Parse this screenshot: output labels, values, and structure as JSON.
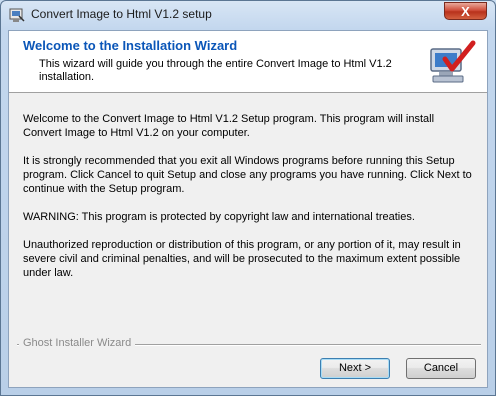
{
  "window": {
    "title": "Convert Image to Html V1.2 setup",
    "close_glyph": "X"
  },
  "header": {
    "title": "Welcome to the Installation Wizard",
    "subtitle": "This wizard will guide you through the entire Convert Image to Html V1.2 installation."
  },
  "body": {
    "paragraphs": [
      "Welcome to the Convert Image to Html V1.2 Setup program. This program will install Convert Image to Html V1.2 on your computer.",
      "It is strongly recommended that you exit all Windows programs before running this Setup program. Click Cancel to quit Setup and close any programs you have running. Click Next to continue with the Setup program.",
      "WARNING: This program is protected by copyright law and international treaties.",
      "Unauthorized reproduction or distribution of this program, or any portion of it, may result in severe civil and criminal penalties, and will be prosecuted to the maximum extent possible under law."
    ]
  },
  "footer": {
    "group_label": "Ghost Installer Wizard",
    "next_label": "Next >",
    "cancel_label": "Cancel"
  },
  "icons": {
    "app": "installer-app-icon",
    "header": "computer-checkmark-icon",
    "close": "close-icon"
  }
}
